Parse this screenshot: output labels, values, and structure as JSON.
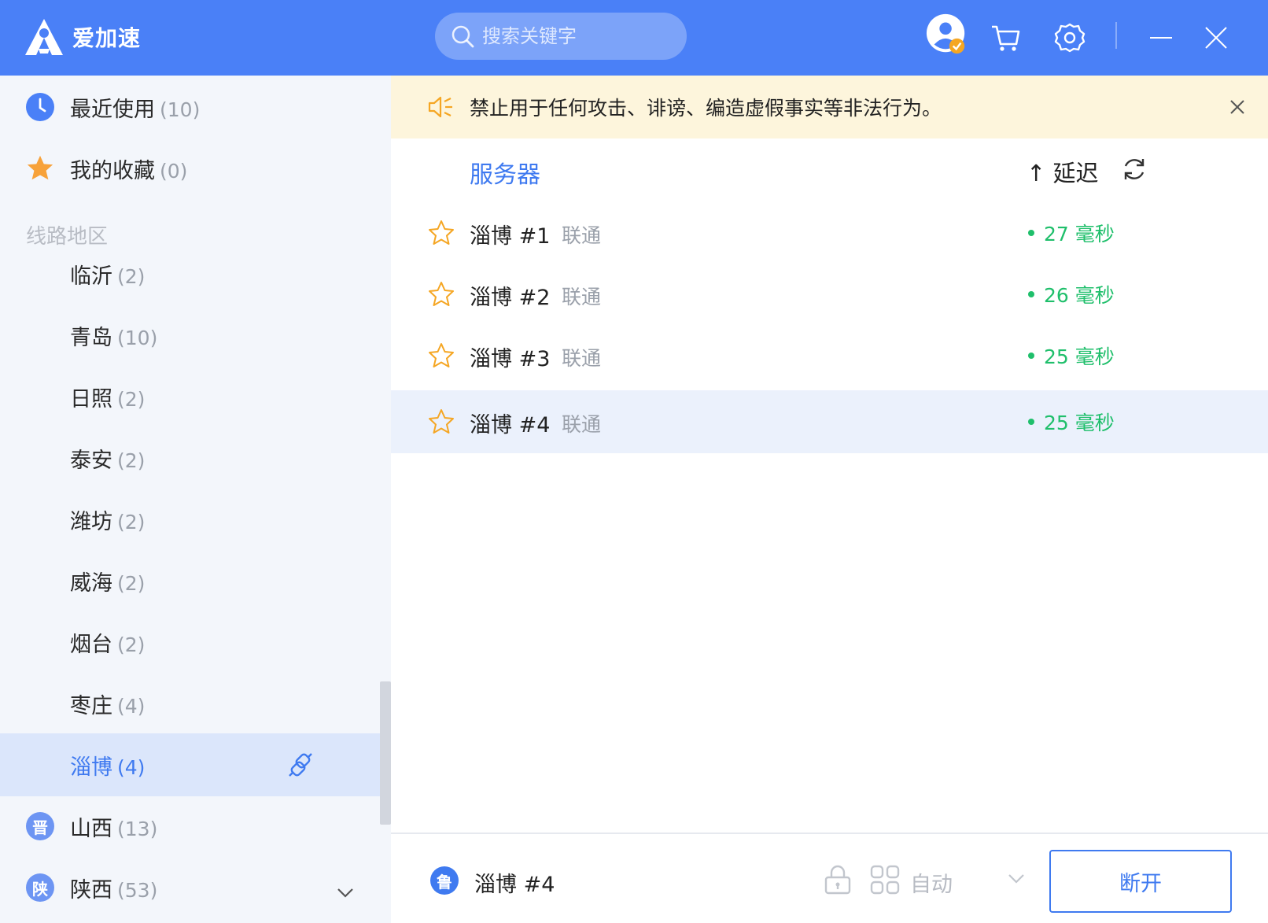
{
  "app": {
    "title": "爱加速"
  },
  "search": {
    "placeholder": "搜索关键字"
  },
  "header_icons": [
    "user-avatar-icon",
    "cart-icon",
    "settings-icon",
    "minimize-icon",
    "close-icon"
  ],
  "colors": {
    "brand": "#4a80f7",
    "accent": "#3f7af0",
    "latency_good": "#1fbf6b",
    "notice_bg": "#fdf5dc",
    "star": "#f5a623"
  },
  "sidebar": {
    "recent": {
      "label": "最近使用",
      "count": "(10)"
    },
    "favorites": {
      "label": "我的收藏",
      "count": "(0)"
    },
    "region_title": "线路地区",
    "cities": [
      {
        "label": "临沂",
        "count": "(2)"
      },
      {
        "label": "青岛",
        "count": "(10)"
      },
      {
        "label": "日照",
        "count": "(2)"
      },
      {
        "label": "泰安",
        "count": "(2)"
      },
      {
        "label": "潍坊",
        "count": "(2)"
      },
      {
        "label": "威海",
        "count": "(2)"
      },
      {
        "label": "烟台",
        "count": "(2)"
      },
      {
        "label": "枣庄",
        "count": "(4)"
      },
      {
        "label": "淄博",
        "count": "(4)"
      }
    ],
    "provinces": [
      {
        "badge": "晋",
        "label": "山西",
        "count": "(13)"
      },
      {
        "badge": "陕",
        "label": "陕西",
        "count": "(53)"
      }
    ]
  },
  "notice": {
    "text": "禁止用于任何攻击、诽谤、编造虚假事实等非法行为。"
  },
  "columns": {
    "server": "服务器",
    "latency": "↑ 延迟"
  },
  "servers": [
    {
      "name": "淄博 #1",
      "isp": "联通",
      "ping": "27 毫秒"
    },
    {
      "name": "淄博 #2",
      "isp": "联通",
      "ping": "26 毫秒"
    },
    {
      "name": "淄博 #3",
      "isp": "联通",
      "ping": "25 毫秒"
    },
    {
      "name": "淄博 #4",
      "isp": "联通",
      "ping": "25 毫秒"
    }
  ],
  "footer": {
    "current_badge": "鲁",
    "current_server": "淄博 #4",
    "mode": "自动",
    "disconnect": "断开"
  }
}
